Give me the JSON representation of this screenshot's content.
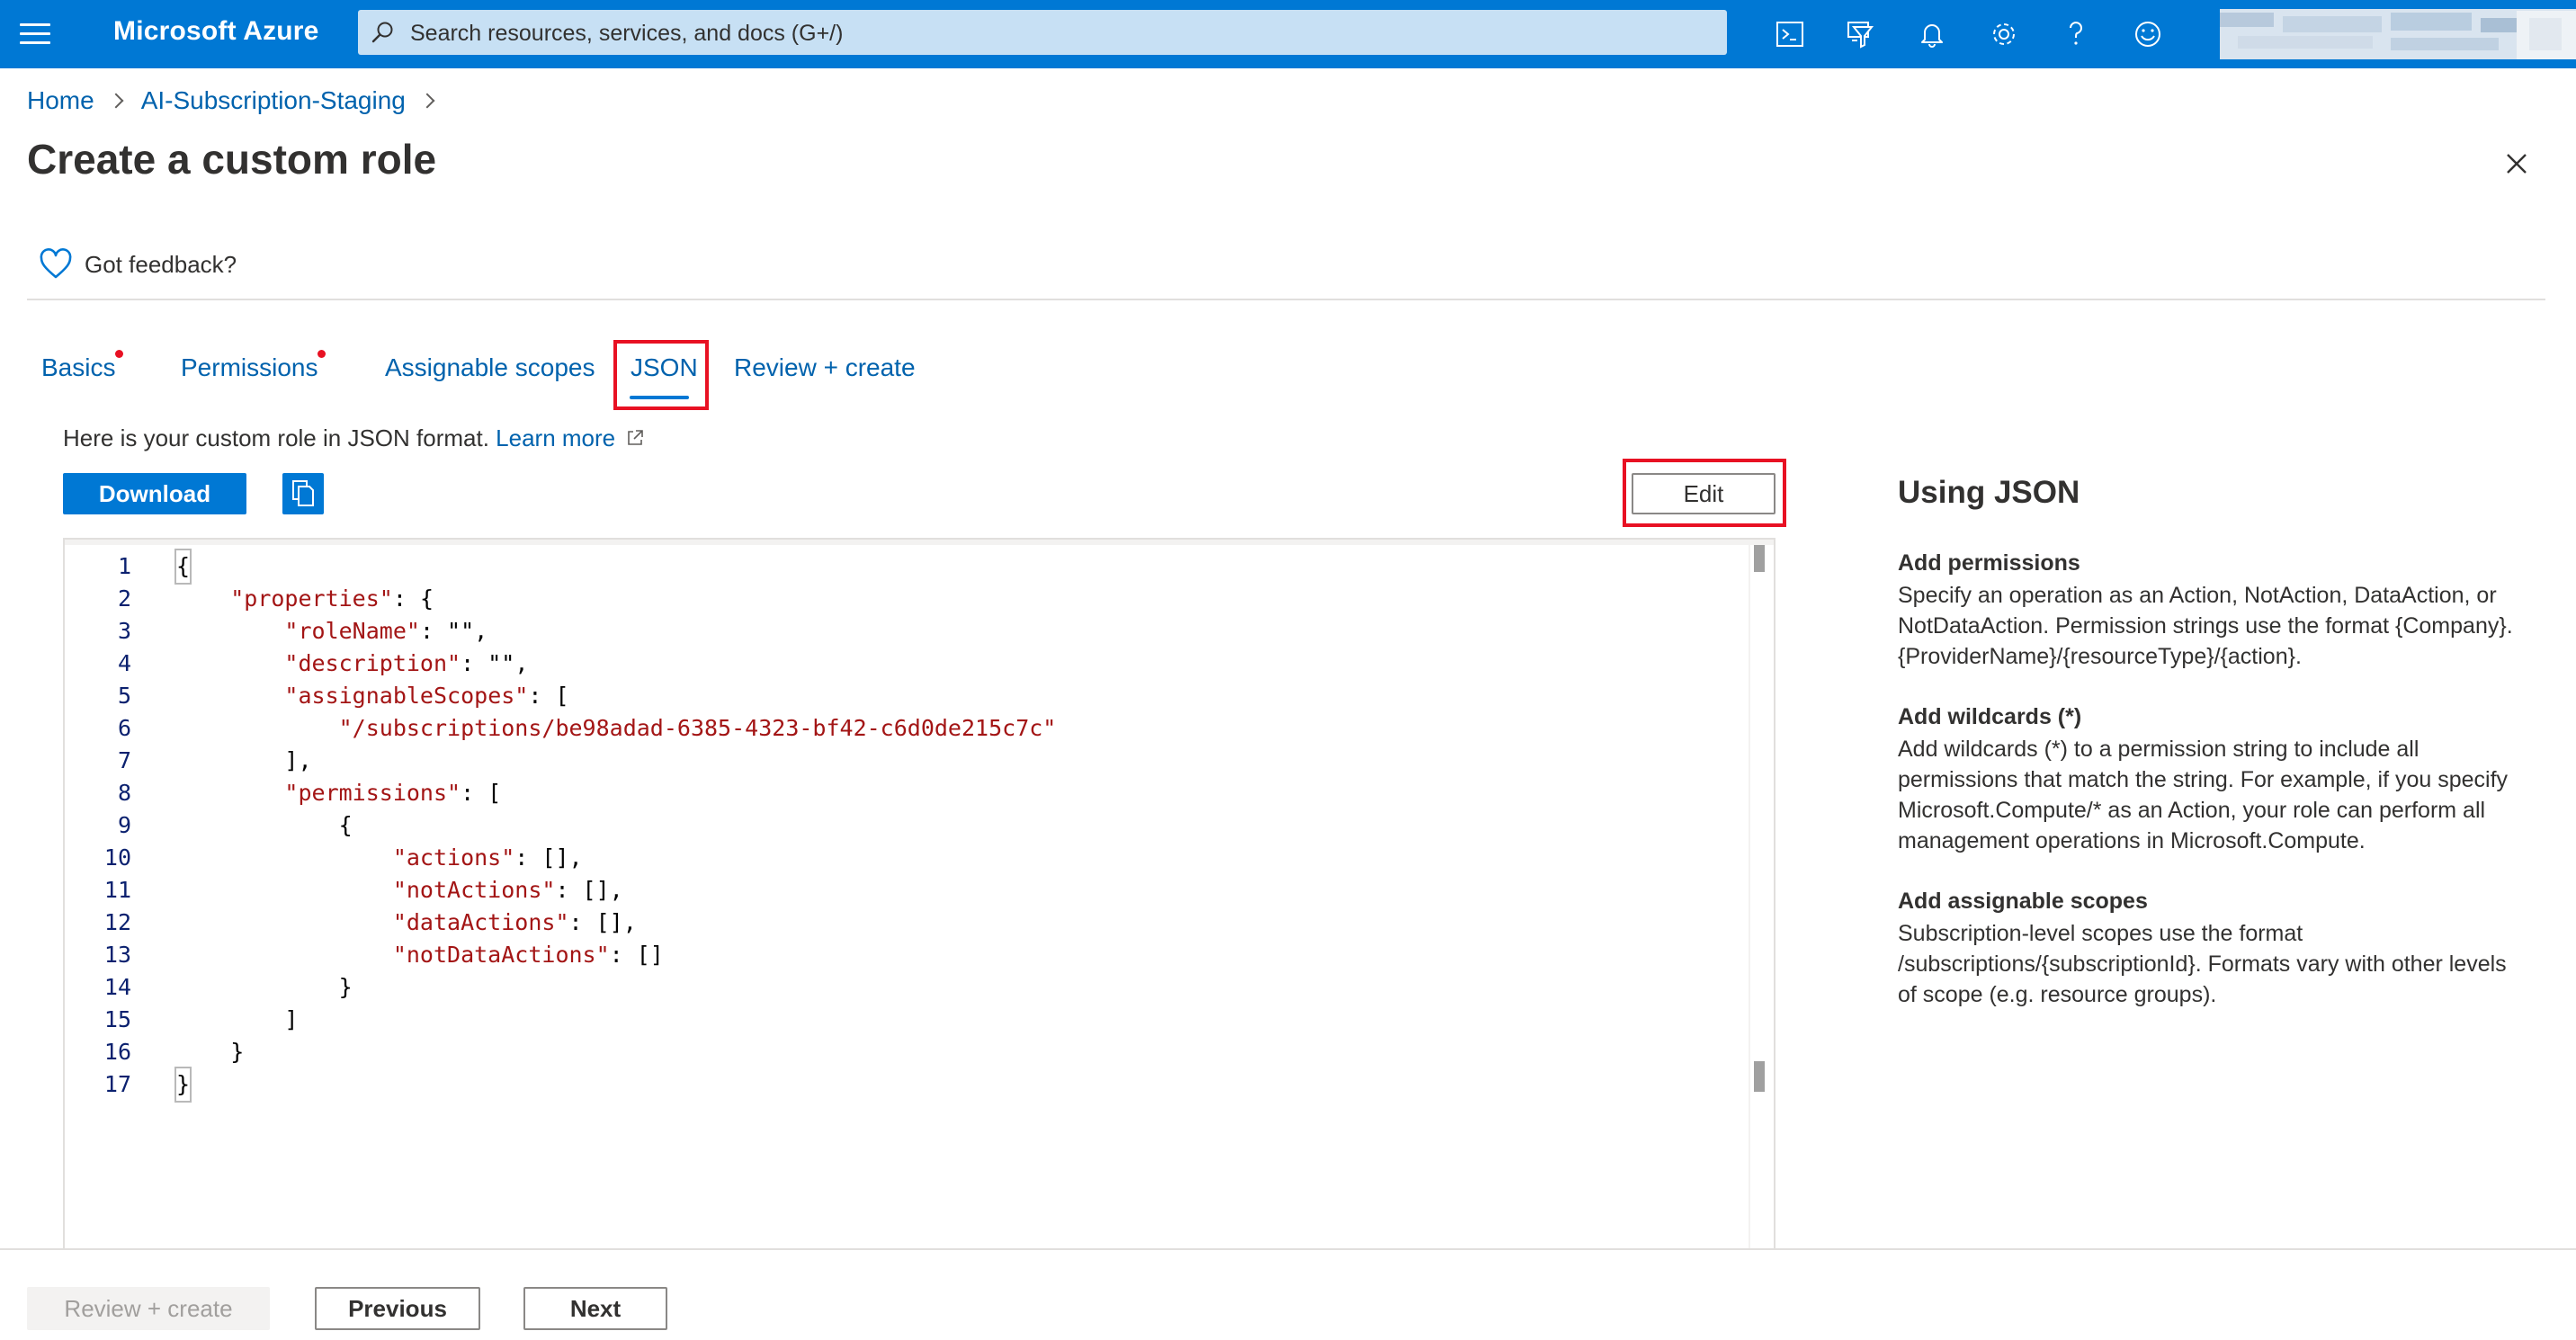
{
  "topbar": {
    "brand": "Microsoft Azure",
    "search_placeholder": "Search resources, services, and docs (G+/)",
    "icons": [
      "menu-icon",
      "cloud-shell-icon",
      "directory-filter-icon",
      "notifications-icon",
      "settings-icon",
      "help-icon",
      "feedback-smiley-icon"
    ],
    "accent": "#0078d4"
  },
  "breadcrumb": {
    "home": "Home",
    "subscription": "AI-Subscription-Staging"
  },
  "page": {
    "title": "Create a custom role",
    "feedback": "Got feedback?"
  },
  "tabs": [
    {
      "label": "Basics",
      "required": true
    },
    {
      "label": "Permissions",
      "required": true
    },
    {
      "label": "Assignable scopes",
      "required": false
    },
    {
      "label": "JSON",
      "required": false,
      "active": true
    },
    {
      "label": "Review + create",
      "required": false
    }
  ],
  "json_tab": {
    "intro": "Here is your custom role in JSON format.",
    "learn_more": "Learn more",
    "download_label": "Download",
    "edit_label": "Edit"
  },
  "editor": {
    "lines": [
      {
        "num": "1",
        "text": "{"
      },
      {
        "num": "2",
        "text": "    \"properties\": {"
      },
      {
        "num": "3",
        "text": "        \"roleName\": \"\","
      },
      {
        "num": "4",
        "text": "        \"description\": \"\","
      },
      {
        "num": "5",
        "text": "        \"assignableScopes\": ["
      },
      {
        "num": "6",
        "text": "            \"/subscriptions/be98adad-6385-4323-bf42-c6d0de215c7c\""
      },
      {
        "num": "7",
        "text": "        ],"
      },
      {
        "num": "8",
        "text": "        \"permissions\": ["
      },
      {
        "num": "9",
        "text": "            {"
      },
      {
        "num": "10",
        "text": "                \"actions\": [],"
      },
      {
        "num": "11",
        "text": "                \"notActions\": [],"
      },
      {
        "num": "12",
        "text": "                \"dataActions\": [],"
      },
      {
        "num": "13",
        "text": "                \"notDataActions\": []"
      },
      {
        "num": "14",
        "text": "            }"
      },
      {
        "num": "15",
        "text": "        ]"
      },
      {
        "num": "16",
        "text": "    }"
      },
      {
        "num": "17",
        "text": "}"
      }
    ]
  },
  "help": {
    "title": "Using JSON",
    "sections": [
      {
        "heading": "Add permissions",
        "body": "Specify an operation as an Action, NotAction, DataAction, or NotDataAction. Permission strings use the format {Company}.{ProviderName}/{resourceType}/{action}."
      },
      {
        "heading": "Add wildcards (*)",
        "body": "Add wildcards (*) to a permission string to include all permissions that match the string. For example, if you specify Microsoft.Compute/* as an Action, your role can perform all management operations in Microsoft.Compute."
      },
      {
        "heading": "Add assignable scopes",
        "body": "Subscription-level scopes use the format /subscriptions/{subscriptionId}. Formats vary with other levels of scope (e.g. resource groups)."
      }
    ]
  },
  "footer": {
    "review_create": "Review + create",
    "previous": "Previous",
    "next": "Next"
  }
}
